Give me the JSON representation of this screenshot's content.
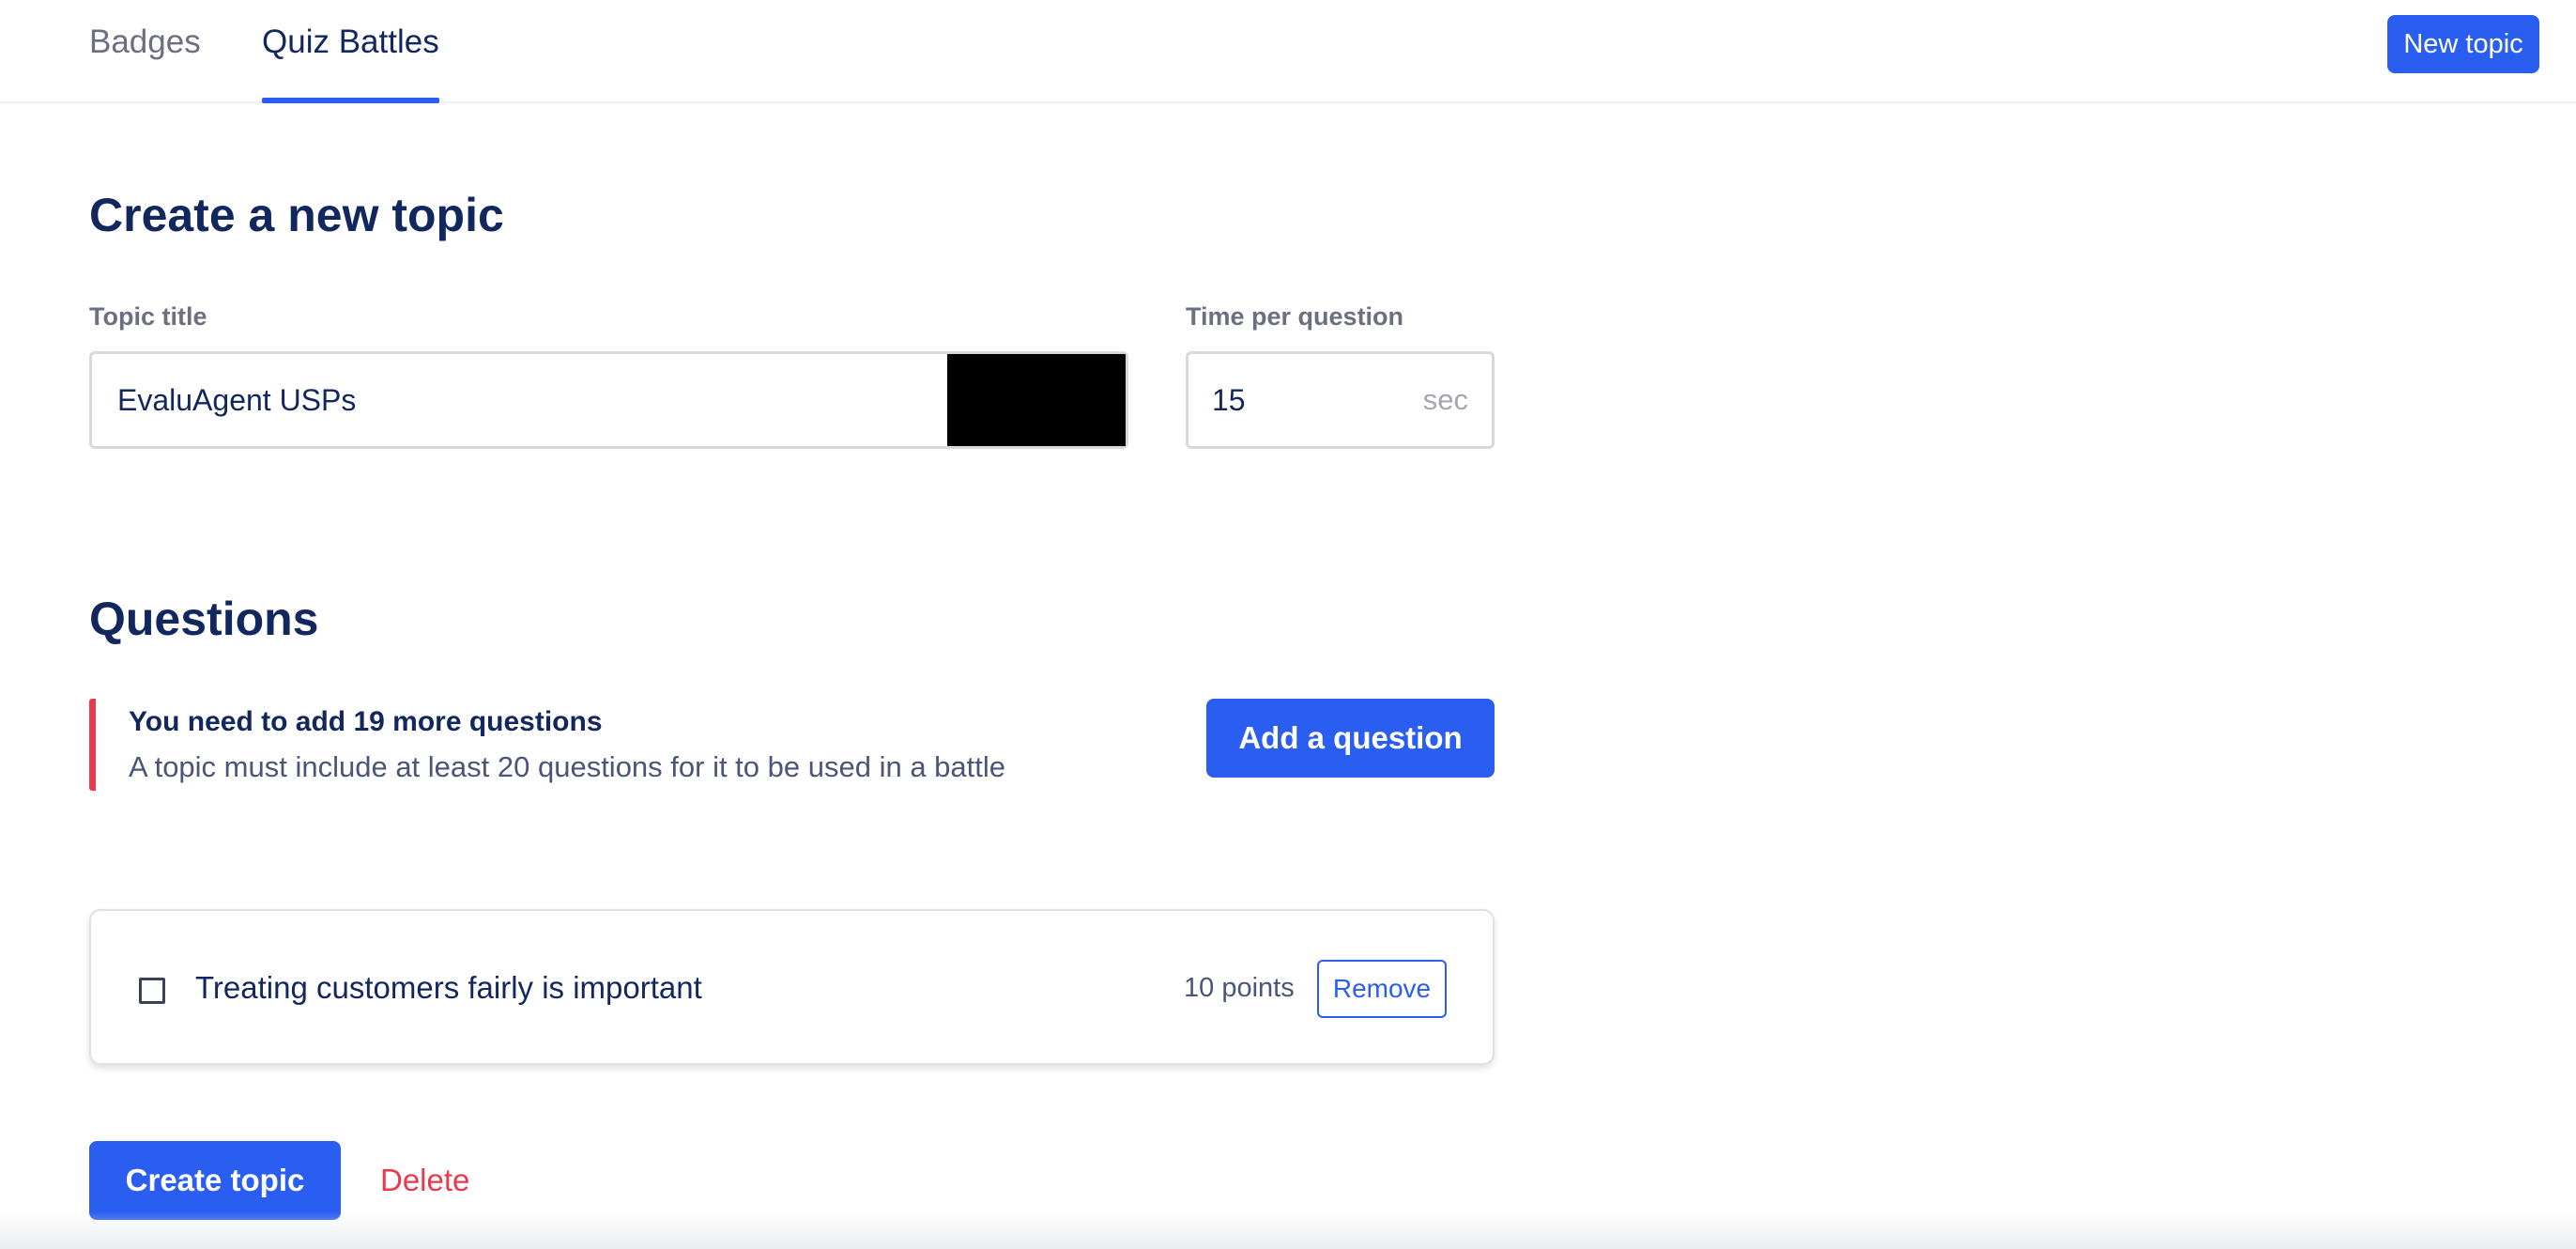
{
  "tabs": [
    {
      "label": "Badges",
      "active": false
    },
    {
      "label": "Quiz Battles",
      "active": true
    }
  ],
  "header": {
    "new_topic_label": "New topic"
  },
  "form": {
    "heading": "Create a new topic",
    "topic_title_label": "Topic title",
    "topic_title_value": "EvaluAgent USPs",
    "time_label": "Time per question",
    "time_value": "15",
    "time_unit": "sec"
  },
  "questions": {
    "heading": "Questions",
    "alert_title": "You need to add 19 more questions",
    "alert_message": "A topic must include at least 20 questions for it to be used in a battle",
    "add_label": "Add a question",
    "items": [
      {
        "text": "Treating customers fairly is important",
        "points": "10 points",
        "remove_label": "Remove",
        "checked": false
      }
    ]
  },
  "footer": {
    "create_label": "Create topic",
    "delete_label": "Delete"
  },
  "colors": {
    "accent": "#2a5ef0",
    "danger": "#e8394d",
    "heading": "#12275e"
  }
}
